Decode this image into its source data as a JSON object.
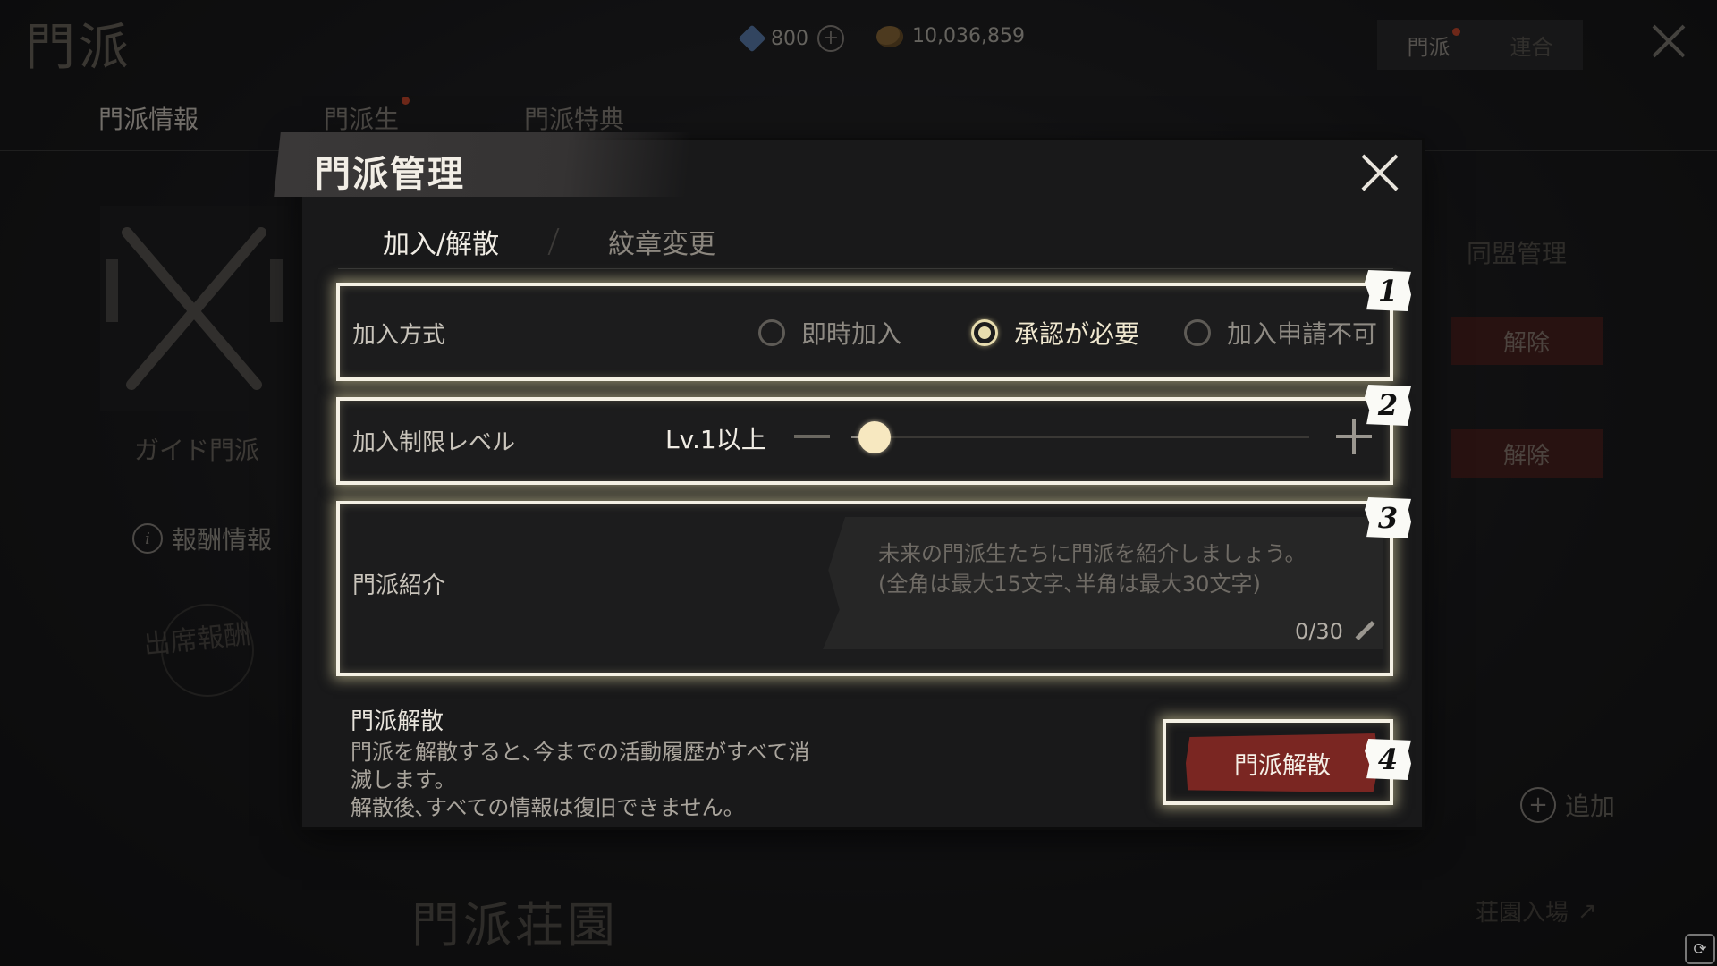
{
  "app": {
    "title": "門派",
    "currency": {
      "gems": "800",
      "gold": "10,036,859"
    },
    "top_tabs": [
      {
        "label": "門派",
        "has_dot": true
      },
      {
        "label": "連合",
        "has_dot": false
      }
    ]
  },
  "background": {
    "tabs": [
      {
        "label": "門派情報",
        "active": true
      },
      {
        "label": "門派生",
        "has_dot": true
      },
      {
        "label": "門派特典"
      }
    ],
    "guild_name": "ガイド門派",
    "reward_info": "報酬情報",
    "attendance": "出席報酬",
    "estate_title": "門派荘園",
    "alliance_manage": "同盟管理",
    "release_buttons": [
      "解除",
      "解除"
    ],
    "add_label": "追加",
    "estate_enter": "荘園入場"
  },
  "modal": {
    "title": "門派管理",
    "tabs": [
      {
        "label": "加入/解散",
        "active": true
      },
      {
        "label": "紋章変更",
        "active": false
      }
    ],
    "join_method": {
      "label": "加入方式",
      "options": [
        {
          "label": "即時加入",
          "checked": false
        },
        {
          "label": "承認が必要",
          "checked": true
        },
        {
          "label": "加入申請不可",
          "checked": false
        }
      ]
    },
    "level_limit": {
      "label": "加入制限レベル",
      "value_text": "Lv.1以上",
      "slider_fraction": 0.05
    },
    "introduction": {
      "label": "門派紹介",
      "placeholder_line1": "未来の門派生たちに門派を紹介しましょう。",
      "placeholder_line2": "(全角は最大15文字､半角は最大30文字)",
      "count": "0/30"
    },
    "dissolve": {
      "title": "門派解散",
      "desc_line1": "門派を解散すると､今までの活動履歴がすべて消",
      "desc_line2": "滅します。",
      "desc_line3": "解散後､すべての情報は復旧できません。",
      "button": "門派解散"
    },
    "badges": [
      "1",
      "2",
      "3",
      "4"
    ]
  },
  "colors": {
    "highlight": "#f5f1e4",
    "danger_button": "#7a2622",
    "knob": "#f7e8c0"
  }
}
